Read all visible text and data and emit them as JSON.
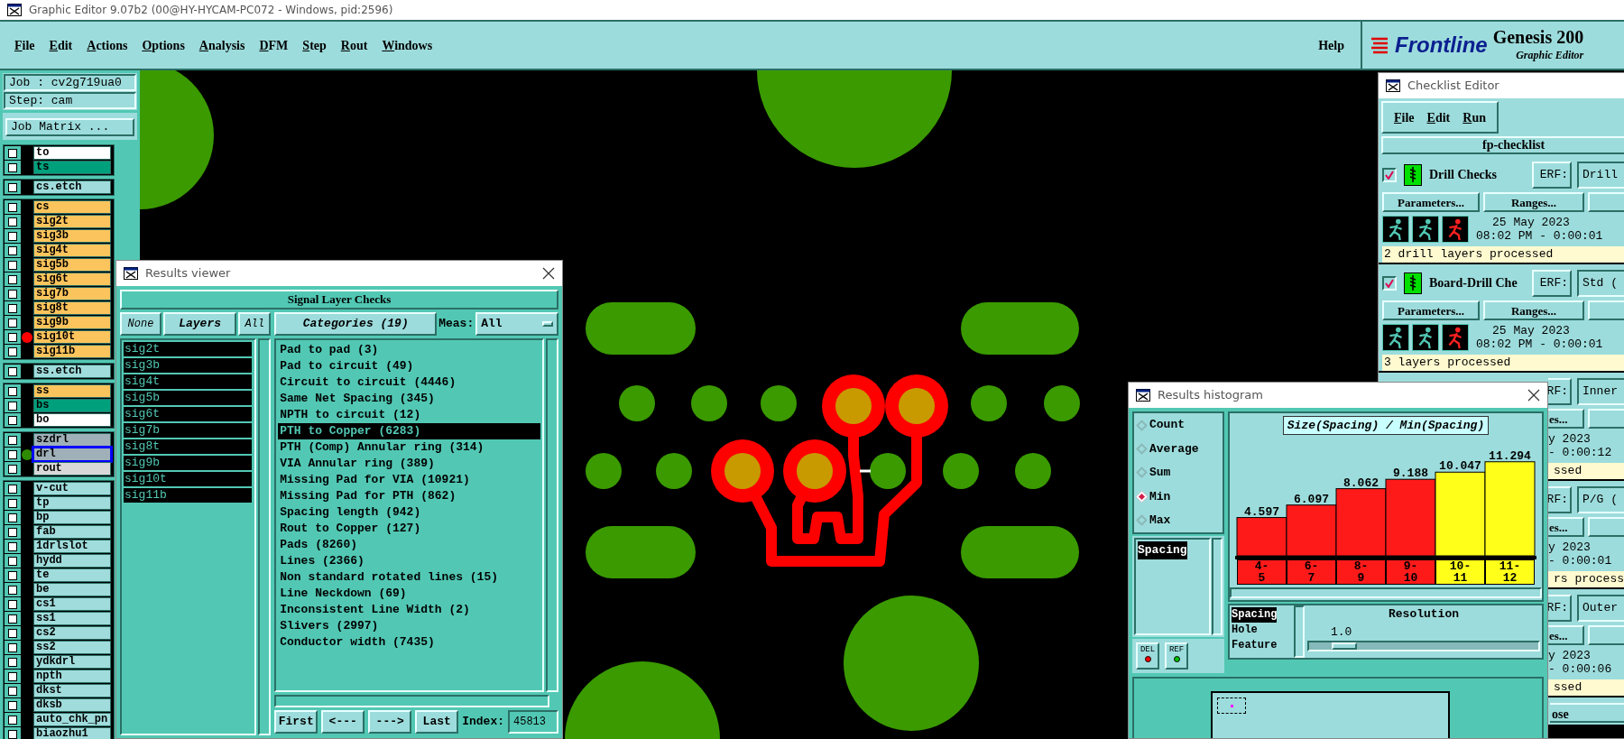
{
  "window": {
    "title": "Graphic Editor 9.07b2 (00@HY-HYCAM-PC072 - Windows, pid:2596)"
  },
  "menu": [
    "File",
    "Edit",
    "Actions",
    "Options",
    "Analysis",
    "DFM",
    "Step",
    "Rout",
    "Windows"
  ],
  "help": "Help",
  "logo": {
    "brand": "Frontline",
    "product": "Genesis 200",
    "subtitle": "Graphic Editor"
  },
  "job": {
    "job": "Job : cv2g719ua0",
    "step": "Step: cam",
    "matrix_button": "Job Matrix ..."
  },
  "layer_groups": [
    [
      {
        "name": "to",
        "kind": "board",
        "selected": false,
        "checked": false
      },
      {
        "name": "ts",
        "kind": "mask",
        "selected": false,
        "checked": false
      }
    ],
    [
      {
        "name": "cs.etch",
        "kind": "document",
        "selected": false,
        "checked": false
      }
    ],
    [
      {
        "name": "cs",
        "kind": "signal",
        "selected": false,
        "checked": false
      },
      {
        "name": "sig2t",
        "kind": "signal",
        "selected": false,
        "checked": false
      },
      {
        "name": "sig3b",
        "kind": "signal",
        "selected": false,
        "checked": false
      },
      {
        "name": "sig4t",
        "kind": "signal",
        "selected": false,
        "checked": false
      },
      {
        "name": "sig5b",
        "kind": "signal",
        "selected": false,
        "checked": false
      },
      {
        "name": "sig6t",
        "kind": "signal",
        "selected": false,
        "checked": false
      },
      {
        "name": "sig7b",
        "kind": "signal",
        "selected": false,
        "checked": false
      },
      {
        "name": "sig8t",
        "kind": "signal",
        "selected": false,
        "checked": false
      },
      {
        "name": "sig9b",
        "kind": "signal",
        "selected": false,
        "checked": false
      },
      {
        "name": "sig10t",
        "kind": "signal",
        "selected": false,
        "checked": false,
        "color": "#ff0000"
      },
      {
        "name": "sig11b",
        "kind": "signal",
        "selected": false,
        "checked": false
      }
    ],
    [
      {
        "name": "ss.etch",
        "kind": "document",
        "selected": false,
        "checked": false
      }
    ],
    [
      {
        "name": "ss",
        "kind": "signal",
        "selected": false,
        "checked": false
      },
      {
        "name": "bs",
        "kind": "mask",
        "selected": false,
        "checked": false
      },
      {
        "name": "bo",
        "kind": "board",
        "selected": false,
        "checked": false
      }
    ],
    [
      {
        "name": "szdrl",
        "kind": "drill",
        "selected": false,
        "checked": false
      },
      {
        "name": "drl",
        "kind": "drill",
        "selected": true,
        "checked": false,
        "color": "#2e8b00"
      },
      {
        "name": "rout",
        "kind": "rout",
        "selected": false,
        "checked": false
      }
    ],
    [
      {
        "name": "v-cut",
        "kind": "document",
        "selected": false,
        "checked": false
      },
      {
        "name": "tp",
        "kind": "document",
        "selected": false,
        "checked": false
      },
      {
        "name": "bp",
        "kind": "document",
        "selected": false,
        "checked": false
      },
      {
        "name": "fab",
        "kind": "document",
        "selected": false,
        "checked": false
      },
      {
        "name": "1drlslot",
        "kind": "document",
        "selected": false,
        "checked": false
      },
      {
        "name": "hydd",
        "kind": "document",
        "selected": false,
        "checked": false
      },
      {
        "name": "te",
        "kind": "document",
        "selected": false,
        "checked": false
      },
      {
        "name": "be",
        "kind": "document",
        "selected": false,
        "checked": false
      },
      {
        "name": "cs1",
        "kind": "document",
        "selected": false,
        "checked": false
      },
      {
        "name": "ss1",
        "kind": "document",
        "selected": false,
        "checked": false
      },
      {
        "name": "cs2",
        "kind": "document",
        "selected": false,
        "checked": false
      },
      {
        "name": "ss2",
        "kind": "document",
        "selected": false,
        "checked": false
      },
      {
        "name": "ydkdrl",
        "kind": "document",
        "selected": false,
        "checked": false
      },
      {
        "name": "npth",
        "kind": "document",
        "selected": false,
        "checked": false
      },
      {
        "name": "dkst",
        "kind": "document",
        "selected": false,
        "checked": false
      },
      {
        "name": "dksb",
        "kind": "document",
        "selected": false,
        "checked": false
      },
      {
        "name": "auto_chk_pn",
        "kind": "document",
        "selected": false,
        "checked": false
      },
      {
        "name": "biaozhu1",
        "kind": "document",
        "selected": false,
        "checked": false
      }
    ]
  ],
  "results_viewer": {
    "title": "Results viewer",
    "heading": "Signal Layer Checks",
    "none_button": "None",
    "layers_button": "Layers",
    "all_button": "All",
    "categories_button": "Categories (19)",
    "meas_label": "Meas:",
    "meas_value": "All",
    "layers": [
      {
        "name": "sig2t",
        "selected": true
      },
      {
        "name": "sig3b",
        "selected": true
      },
      {
        "name": "sig4t",
        "selected": true
      },
      {
        "name": "sig5b",
        "selected": true
      },
      {
        "name": "sig6t",
        "selected": true
      },
      {
        "name": "sig7b",
        "selected": true
      },
      {
        "name": "sig8t",
        "selected": true
      },
      {
        "name": "sig9b",
        "selected": true
      },
      {
        "name": "sig10t",
        "selected": true
      },
      {
        "name": "sig11b",
        "selected": true
      }
    ],
    "categories": [
      {
        "label": "Pad to pad (3)",
        "selected": false
      },
      {
        "label": "Pad to circuit (49)",
        "selected": false
      },
      {
        "label": "Circuit to circuit (4446)",
        "selected": false
      },
      {
        "label": "Same Net Spacing (345)",
        "selected": false
      },
      {
        "label": "NPTH to circuit (12)",
        "selected": false
      },
      {
        "label": "PTH to Copper (6283)",
        "selected": true
      },
      {
        "label": "PTH (Comp) Annular ring (314)",
        "selected": false
      },
      {
        "label": "VIA Annular ring (389)",
        "selected": false
      },
      {
        "label": "Missing Pad for VIA (10921)",
        "selected": false
      },
      {
        "label": "Missing Pad for PTH (862)",
        "selected": false
      },
      {
        "label": "Spacing length (942)",
        "selected": false
      },
      {
        "label": "Rout to Copper (127)",
        "selected": false
      },
      {
        "label": "Pads (8260)",
        "selected": false
      },
      {
        "label": "Lines (2366)",
        "selected": false
      },
      {
        "label": "Non standard rotated lines (15)",
        "selected": false
      },
      {
        "label": "Line Neckdown (69)",
        "selected": false
      },
      {
        "label": "Inconsistent Line Width (2)",
        "selected": false
      },
      {
        "label": "Slivers (2997)",
        "selected": false
      },
      {
        "label": "Conductor width (7435)",
        "selected": false
      }
    ],
    "nav": [
      "First",
      "<---",
      "--->",
      "Last"
    ],
    "index_label": "Index:",
    "index_value": "45813"
  },
  "histogram": {
    "title": "Results histogram",
    "modes": [
      {
        "label": "Count",
        "selected": false
      },
      {
        "label": "Average",
        "selected": false
      },
      {
        "label": "Sum",
        "selected": false
      },
      {
        "label": "Min",
        "selected": true
      },
      {
        "label": "Max",
        "selected": false
      }
    ],
    "measures": [
      {
        "label": "Spacing",
        "selected": true
      }
    ],
    "del_button": "DEL",
    "ref_button": "REF",
    "chart_data": {
      "type": "bar",
      "title": "Size(Spacing) / Min(Spacing)",
      "categories": [
        "4-\n5",
        "6-\n7",
        "8-\n9",
        "9-\n10",
        "10-\n11",
        "11-\n12"
      ],
      "data_labels": true,
      "series": [
        {
          "color": "#ff1a1a",
          "values": [
            4.597,
            6.097,
            8.062,
            9.188,
            null,
            null
          ]
        },
        {
          "color": "#ffff1a",
          "values": [
            null,
            null,
            null,
            null,
            10.047,
            11.294
          ]
        }
      ]
    },
    "types": [
      {
        "label": "Spacing",
        "selected": true
      },
      {
        "label": "Hole",
        "selected": false
      },
      {
        "label": "Feature",
        "selected": false
      }
    ],
    "resolution_label": "Resolution",
    "resolution_value": "1.0",
    "level": 0.1
  },
  "checklist": {
    "title": "Checklist Editor",
    "menu": [
      "File",
      "Edit",
      "Run"
    ],
    "name": "fp-checklist",
    "items": [
      {
        "kind": "full",
        "checked": true,
        "name": "Drill Checks",
        "erf": "ERF:",
        "erf_value": "Drill",
        "parameters": "Parameters...",
        "ranges": "Ranges...",
        "date": "25 May 2023",
        "time": "08:02 PM - 0:00:01",
        "status": "2 drill layers processed"
      },
      {
        "kind": "full",
        "checked": true,
        "name": "Board-Drill Che",
        "erf": "ERF:",
        "erf_value": "Std (",
        "parameters": "Parameters...",
        "ranges": "Ranges...",
        "date": "25 May 2023",
        "time": "08:02 PM - 0:00:01",
        "status": "3 layers processed"
      },
      {
        "kind": "covered",
        "erf": "RF:",
        "erf_value": "Inner",
        "ranges": "es...",
        "date": "y 2023",
        "time": "- 0:00:12",
        "status": "ssed"
      },
      {
        "kind": "covered",
        "erf": "RF:",
        "erf_value": "P/G (",
        "ranges": "es...",
        "date": "y 2023",
        "time": "- 0:00:01",
        "status": "rs process"
      },
      {
        "kind": "covered",
        "erf": "RF:",
        "erf_value": "Outer",
        "ranges": "es...",
        "date": "y 2023",
        "time": "- 0:00:06",
        "status": "ssed"
      }
    ],
    "close_button": "ose"
  }
}
